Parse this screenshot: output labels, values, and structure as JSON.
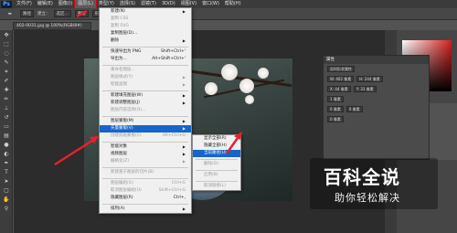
{
  "app": {
    "logo": "Ps"
  },
  "menubar": {
    "items": [
      {
        "label": "文件(F)"
      },
      {
        "label": "编辑(E)"
      },
      {
        "label": "图像(I)"
      },
      {
        "label": "图层(L)"
      },
      {
        "label": "类型(Y)"
      },
      {
        "label": "选择(S)"
      },
      {
        "label": "滤镜(T)"
      },
      {
        "label": "3D(D)"
      },
      {
        "label": "视图(V)"
      },
      {
        "label": "窗口(W)"
      },
      {
        "label": "帮助(H)"
      }
    ]
  },
  "options": {
    "mode": "路径",
    "make": "建立：",
    "selection": "选区...",
    "mask": "蒙版",
    "shape": "形状"
  },
  "document": {
    "tab_title": "402-0031.jpg @ 100%(RGB/8#)"
  },
  "layer_menu": {
    "items": [
      {
        "label": "新建(N)",
        "shortcut": "",
        "arrow": true,
        "disabled": false
      },
      {
        "label": "复制 CSS",
        "shortcut": "",
        "disabled": true
      },
      {
        "label": "复制 SVG",
        "shortcut": "",
        "disabled": true
      },
      {
        "label": "复制图层(D)...",
        "shortcut": "",
        "disabled": false
      },
      {
        "label": "删除",
        "shortcut": "",
        "arrow": true,
        "disabled": false
      },
      {
        "sep": true
      },
      {
        "label": "快速导出为 PNG",
        "shortcut": "Shift+Ctrl+'",
        "disabled": false
      },
      {
        "label": "导出为...",
        "shortcut": "Alt+Shift+Ctrl+'",
        "disabled": false
      },
      {
        "sep": true
      },
      {
        "label": "重命名图层...",
        "shortcut": "",
        "disabled": true
      },
      {
        "label": "图层样式(Y)",
        "shortcut": "",
        "arrow": true,
        "disabled": true
      },
      {
        "label": "智能滤镜",
        "shortcut": "",
        "arrow": true,
        "disabled": true
      },
      {
        "sep": true
      },
      {
        "label": "新建填充图层(W)",
        "shortcut": "",
        "arrow": true,
        "disabled": false
      },
      {
        "label": "新建调整图层(J)",
        "shortcut": "",
        "arrow": true,
        "disabled": false
      },
      {
        "label": "图层内容选项(O)...",
        "shortcut": "",
        "disabled": true
      },
      {
        "sep": true
      },
      {
        "label": "图层蒙版(M)",
        "shortcut": "",
        "arrow": true,
        "disabled": false
      },
      {
        "label": "矢量蒙版(V)",
        "shortcut": "",
        "arrow": true,
        "disabled": false,
        "highlight": true
      },
      {
        "label": "创建剪贴蒙版(C)",
        "shortcut": "Alt+Ctrl+G",
        "disabled": true
      },
      {
        "sep": true
      },
      {
        "label": "智能对象",
        "shortcut": "",
        "arrow": true,
        "disabled": false
      },
      {
        "label": "视频图层",
        "shortcut": "",
        "arrow": true,
        "disabled": false
      },
      {
        "label": "栅格化(Z)",
        "shortcut": "",
        "arrow": true,
        "disabled": true
      },
      {
        "sep": true
      },
      {
        "label": "新建基于图层的切片(B)",
        "shortcut": "",
        "disabled": true
      },
      {
        "sep": true
      },
      {
        "label": "图层编组(G)",
        "shortcut": "Ctrl+G",
        "disabled": true
      },
      {
        "label": "取消图层编组(U)",
        "shortcut": "Shift+Ctrl+G",
        "disabled": true
      },
      {
        "label": "隐藏图层(R)",
        "shortcut": "Ctrl+,",
        "disabled": false
      },
      {
        "sep": true
      },
      {
        "label": "排列(A)",
        "shortcut": "",
        "arrow": true,
        "disabled": false
      }
    ]
  },
  "vector_mask_menu": {
    "items": [
      {
        "label": "显示全部(R)",
        "disabled": false
      },
      {
        "label": "隐藏全部(H)",
        "disabled": false
      },
      {
        "label": "当前路径(U)",
        "disabled": false,
        "highlight": true
      },
      {
        "sep": true
      },
      {
        "label": "删除(D)",
        "disabled": true
      },
      {
        "sep": true
      },
      {
        "label": "启用(B)",
        "disabled": true
      },
      {
        "sep": true
      },
      {
        "label": "取消链接(L)",
        "disabled": true
      }
    ]
  },
  "properties": {
    "title": "属性",
    "subtitle": "实时形状属性",
    "w": "W: 402 像素",
    "h": "H: 244 像素",
    "x": "X: 44 像素",
    "y": "Y: 33 像素",
    "stroke": "1 像素",
    "corners": "0 像素",
    "row3": "0 像素",
    "row4": "0 像素"
  },
  "watermark": {
    "title": "百科全说",
    "subtitle": "助你轻松解决"
  },
  "colors": {
    "highlight": "#1665cc",
    "arrow": "#e8202a"
  }
}
